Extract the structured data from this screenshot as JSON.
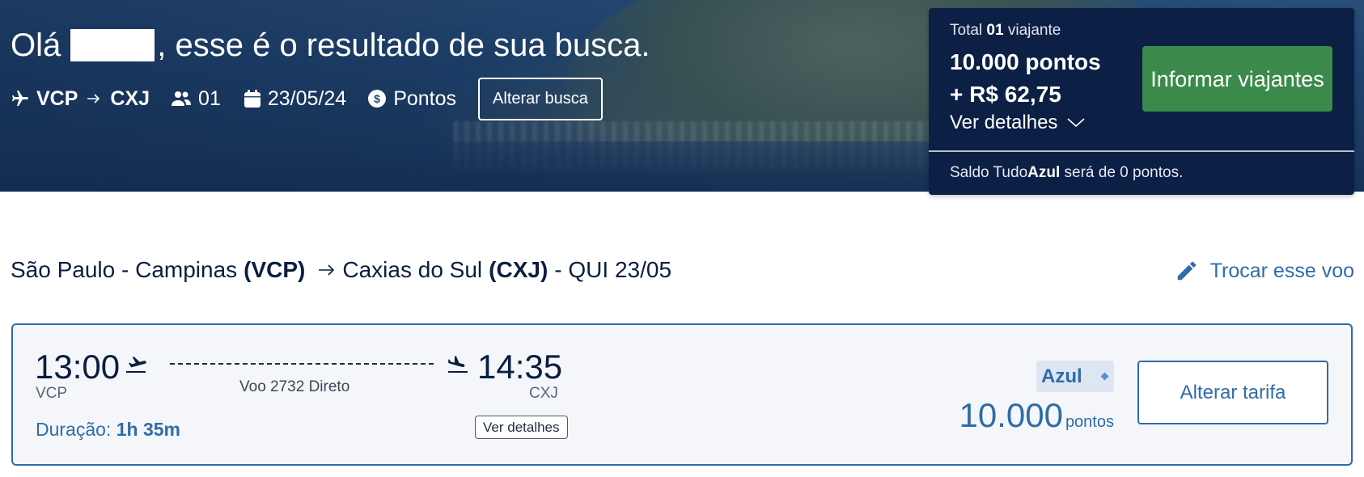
{
  "hero": {
    "greeting_prefix": "Olá",
    "greeting_suffix": ", esse é o resultado de sua busca.",
    "origin": "VCP",
    "destination": "CXJ",
    "passengers": "01",
    "date": "23/05/24",
    "payment_mode": "Pontos",
    "alter_search_label": "Alterar busca",
    "icons": [
      "plane-icon",
      "arrow-right-icon",
      "people-icon",
      "calendar-icon",
      "coin-icon"
    ]
  },
  "summary": {
    "total_prefix": "Total",
    "total_count": "01",
    "total_suffix": "viajante",
    "points_line": "10.000 pontos",
    "money_line": "+ R$ 62,75",
    "details_label": "Ver detalhes",
    "inform_button_label": "Informar viajantes",
    "balance_prefix": "Saldo Tudo",
    "balance_brand": "Azul",
    "balance_suffix": "será de 0 pontos.",
    "colors": {
      "panel_bg": "#0c1f44",
      "button_bg": "#3b8a4c"
    }
  },
  "route": {
    "origin_city": "São Paulo - Campinas",
    "origin_code": "(VCP)",
    "destination_city": "Caxias do Sul",
    "destination_code": "(CXJ)",
    "date_suffix": "- QUI 23/05",
    "change_flight_label": "Trocar esse voo"
  },
  "flight": {
    "departure_time": "13:00",
    "departure_code": "VCP",
    "arrival_time": "14:35",
    "arrival_code": "CXJ",
    "flight_info": "Voo 2732 Direto",
    "duration_label": "Duração:",
    "duration_value": "1h 35m",
    "details_button_label": "Ver detalhes",
    "fare_name": "Azul",
    "price_value": "10.000",
    "price_unit": "pontos",
    "alter_fare_label": "Alterar tarifa",
    "colors": {
      "accent": "#2f6ca8",
      "card_bg": "#f4f6fa"
    }
  }
}
